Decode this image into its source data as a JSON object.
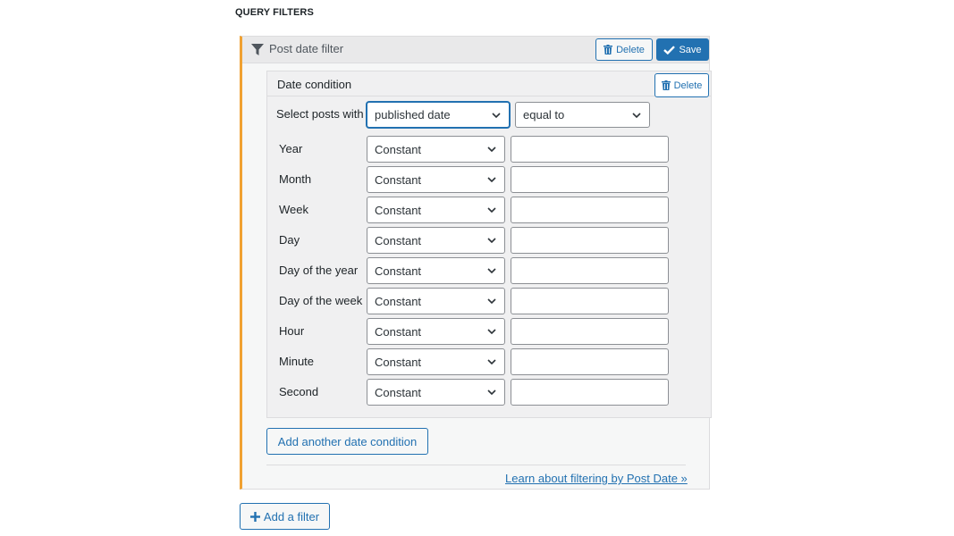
{
  "section": {
    "title": "QUERY FILTERS"
  },
  "filter": {
    "title": "Post date filter",
    "delete_label": "Delete",
    "save_label": "Save"
  },
  "condition": {
    "title": "Date condition",
    "delete_label": "Delete",
    "select_posts_label": "Select posts with",
    "date_field_value": "published date",
    "comparator_value": "equal to",
    "rows": [
      {
        "label": "Year",
        "type": "Constant",
        "value": ""
      },
      {
        "label": "Month",
        "type": "Constant",
        "value": ""
      },
      {
        "label": "Week",
        "type": "Constant",
        "value": ""
      },
      {
        "label": "Day",
        "type": "Constant",
        "value": ""
      },
      {
        "label": "Day of the year",
        "type": "Constant",
        "value": ""
      },
      {
        "label": "Day of the week",
        "type": "Constant",
        "value": ""
      },
      {
        "label": "Hour",
        "type": "Constant",
        "value": ""
      },
      {
        "label": "Minute",
        "type": "Constant",
        "value": ""
      },
      {
        "label": "Second",
        "type": "Constant",
        "value": ""
      }
    ]
  },
  "actions": {
    "add_condition_label": "Add another date condition",
    "learn_link": "Learn about filtering by Post Date »",
    "add_filter_label": "Add a filter"
  },
  "colors": {
    "accent": "#2271b1",
    "filter_border": "#f0a132"
  }
}
